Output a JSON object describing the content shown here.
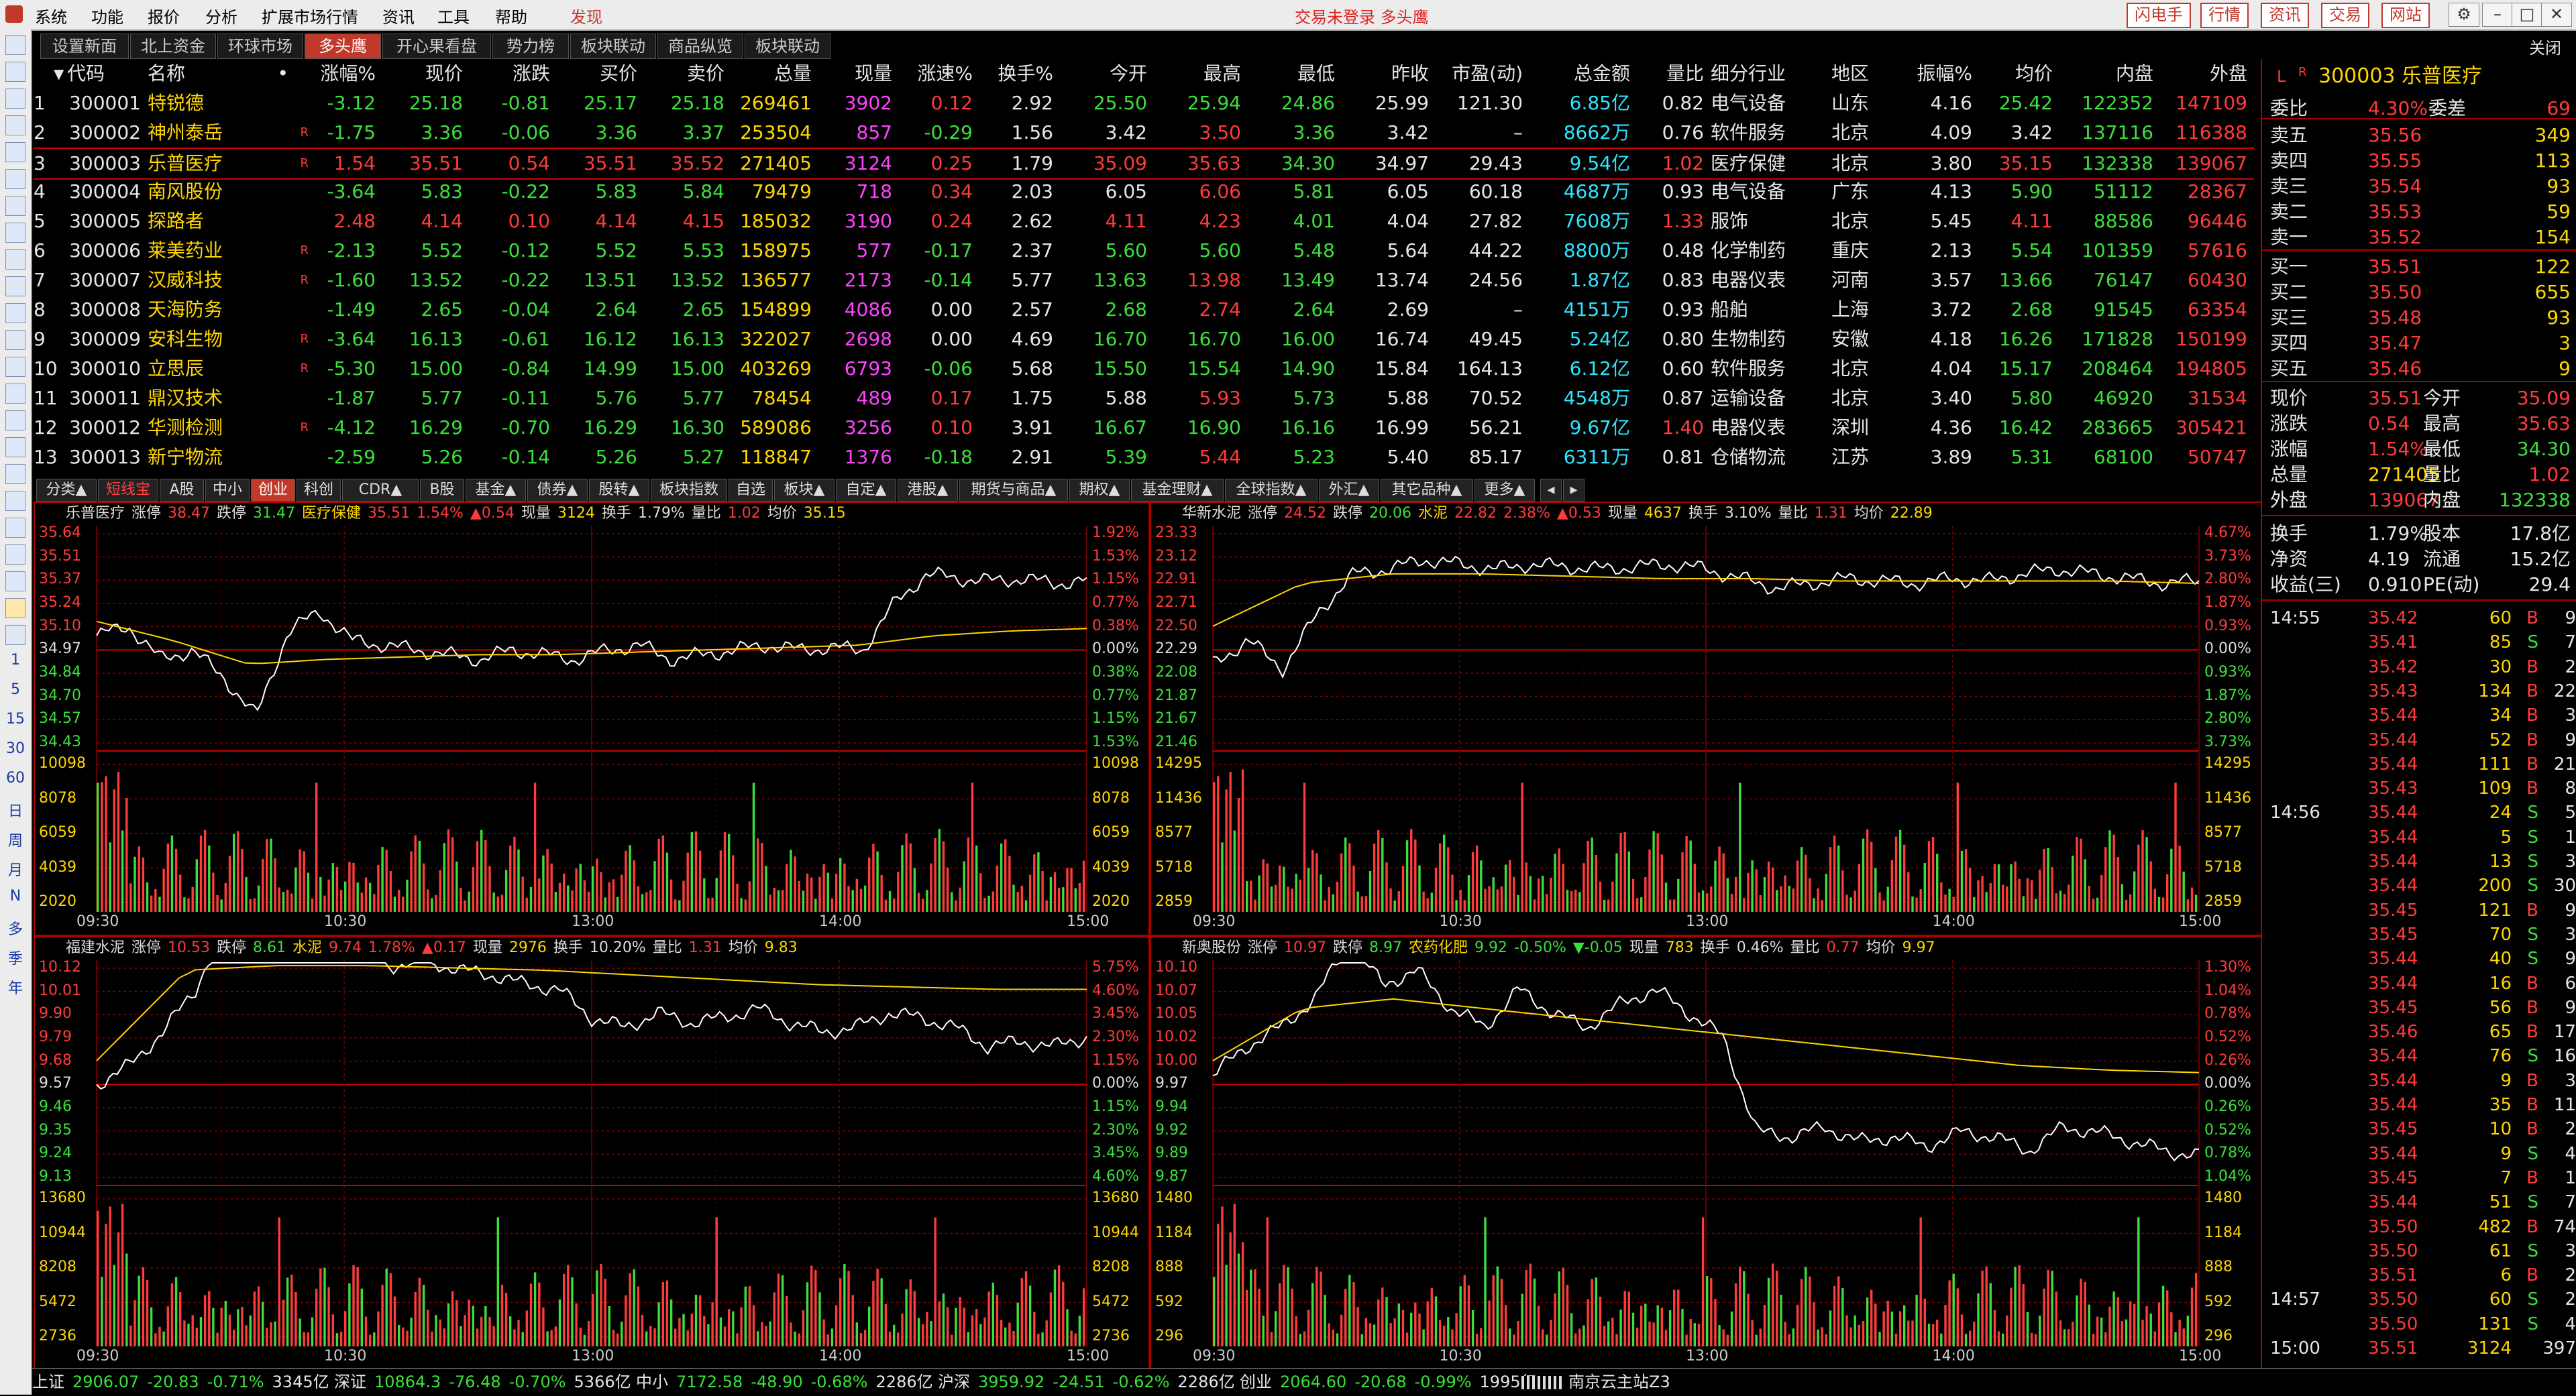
{
  "menubar": {
    "items": [
      "系统",
      "功能",
      "报价",
      "分析",
      "扩展市场行情",
      "资讯",
      "工具",
      "帮助",
      "发现"
    ],
    "notice": "交易未登录 多头鹰",
    "right_buttons": [
      "闪电手",
      "行情",
      "资讯",
      "交易",
      "网站"
    ],
    "close_label": "关闭"
  },
  "left_toolbar": {
    "text_buttons": [
      "1",
      "5",
      "15",
      "30",
      "60",
      "日",
      "周",
      "月",
      "N",
      "多",
      "季",
      "年"
    ]
  },
  "top_tabs": [
    "设置新面",
    "北上资金",
    "环球市场",
    "多头鹰",
    "开心果看盘",
    "势力榜",
    "板块联动",
    "商品纵览",
    "板块联动"
  ],
  "table": {
    "headers": [
      "代码",
      "名称",
      "•",
      "涨幅%",
      "现价",
      "涨跌",
      "买价",
      "卖价",
      "总量",
      "现量",
      "涨速%",
      "换手%",
      "今开",
      "最高",
      "最低",
      "昨收",
      "市盈(动)",
      "总金额",
      "量比",
      "细分行业",
      "地区",
      "振幅%",
      "均价",
      "内盘",
      "外盘"
    ],
    "rows": [
      {
        "n": "1",
        "code": "300001",
        "name": "特锐德",
        "r": "",
        "chg": "-3.12",
        "price": "25.18",
        "diff": "-0.81",
        "bid": "25.17",
        "ask": "25.18",
        "vol": "269461",
        "cur": "3902",
        "spd": "0.12",
        "turn": "2.92",
        "open": "25.50",
        "high": "25.94",
        "low": "24.86",
        "prev": "25.99",
        "pe": "121.30",
        "amt": "6.85亿",
        "vr": "0.82",
        "ind": "电气设备",
        "reg": "山东",
        "amp": "4.16",
        "avg": "25.42",
        "inner": "122352",
        "outer": "147109"
      },
      {
        "n": "2",
        "code": "300002",
        "name": "神州泰岳",
        "r": "R",
        "chg": "-1.75",
        "price": "3.36",
        "diff": "-0.06",
        "bid": "3.36",
        "ask": "3.37",
        "vol": "253504",
        "cur": "857",
        "spd": "-0.29",
        "turn": "1.56",
        "open": "3.42",
        "high": "3.50",
        "low": "3.36",
        "prev": "3.42",
        "pe": "–",
        "amt": "8662万",
        "vr": "0.76",
        "ind": "软件服务",
        "reg": "北京",
        "amp": "4.09",
        "avg": "3.42",
        "inner": "137116",
        "outer": "116388"
      },
      {
        "n": "3",
        "code": "300003",
        "name": "乐普医疗",
        "r": "R",
        "chg": "1.54",
        "price": "35.51",
        "diff": "0.54",
        "bid": "35.51",
        "ask": "35.52",
        "vol": "271405",
        "cur": "3124",
        "spd": "0.25",
        "turn": "1.79",
        "open": "35.09",
        "high": "35.63",
        "low": "34.30",
        "prev": "34.97",
        "pe": "29.43",
        "amt": "9.54亿",
        "vr": "1.02",
        "ind": "医疗保健",
        "reg": "北京",
        "amp": "3.80",
        "avg": "35.15",
        "inner": "132338",
        "outer": "139067"
      },
      {
        "n": "4",
        "code": "300004",
        "name": "南风股份",
        "r": "",
        "chg": "-3.64",
        "price": "5.83",
        "diff": "-0.22",
        "bid": "5.83",
        "ask": "5.84",
        "vol": "79479",
        "cur": "718",
        "spd": "0.34",
        "turn": "2.03",
        "open": "6.05",
        "high": "6.06",
        "low": "5.81",
        "prev": "6.05",
        "pe": "60.18",
        "amt": "4687万",
        "vr": "0.93",
        "ind": "电气设备",
        "reg": "广东",
        "amp": "4.13",
        "avg": "5.90",
        "inner": "51112",
        "outer": "28367"
      },
      {
        "n": "5",
        "code": "300005",
        "name": "探路者",
        "r": "",
        "chg": "2.48",
        "price": "4.14",
        "diff": "0.10",
        "bid": "4.14",
        "ask": "4.15",
        "vol": "185032",
        "cur": "3190",
        "spd": "0.24",
        "turn": "2.62",
        "open": "4.11",
        "high": "4.23",
        "low": "4.01",
        "prev": "4.04",
        "pe": "27.82",
        "amt": "7608万",
        "vr": "1.33",
        "ind": "服饰",
        "reg": "北京",
        "amp": "5.45",
        "avg": "4.11",
        "inner": "88586",
        "outer": "96446"
      },
      {
        "n": "6",
        "code": "300006",
        "name": "莱美药业",
        "r": "R",
        "chg": "-2.13",
        "price": "5.52",
        "diff": "-0.12",
        "bid": "5.52",
        "ask": "5.53",
        "vol": "158975",
        "cur": "577",
        "spd": "-0.17",
        "turn": "2.37",
        "open": "5.60",
        "high": "5.60",
        "low": "5.48",
        "prev": "5.64",
        "pe": "44.22",
        "amt": "8800万",
        "vr": "0.48",
        "ind": "化学制药",
        "reg": "重庆",
        "amp": "2.13",
        "avg": "5.54",
        "inner": "101359",
        "outer": "57616"
      },
      {
        "n": "7",
        "code": "300007",
        "name": "汉威科技",
        "r": "R",
        "chg": "-1.60",
        "price": "13.52",
        "diff": "-0.22",
        "bid": "13.51",
        "ask": "13.52",
        "vol": "136577",
        "cur": "2173",
        "spd": "-0.14",
        "turn": "5.77",
        "open": "13.63",
        "high": "13.98",
        "low": "13.49",
        "prev": "13.74",
        "pe": "24.56",
        "amt": "1.87亿",
        "vr": "0.83",
        "ind": "电器仪表",
        "reg": "河南",
        "amp": "3.57",
        "avg": "13.66",
        "inner": "76147",
        "outer": "60430"
      },
      {
        "n": "8",
        "code": "300008",
        "name": "天海防务",
        "r": "",
        "chg": "-1.49",
        "price": "2.65",
        "diff": "-0.04",
        "bid": "2.64",
        "ask": "2.65",
        "vol": "154899",
        "cur": "4086",
        "spd": "0.00",
        "turn": "2.57",
        "open": "2.68",
        "high": "2.74",
        "low": "2.64",
        "prev": "2.69",
        "pe": "–",
        "amt": "4151万",
        "vr": "0.93",
        "ind": "船舶",
        "reg": "上海",
        "amp": "3.72",
        "avg": "2.68",
        "inner": "91545",
        "outer": "63354"
      },
      {
        "n": "9",
        "code": "300009",
        "name": "安科生物",
        "r": "R",
        "chg": "-3.64",
        "price": "16.13",
        "diff": "-0.61",
        "bid": "16.12",
        "ask": "16.13",
        "vol": "322027",
        "cur": "2698",
        "spd": "0.00",
        "turn": "4.69",
        "open": "16.70",
        "high": "16.70",
        "low": "16.00",
        "prev": "16.74",
        "pe": "49.45",
        "amt": "5.24亿",
        "vr": "0.80",
        "ind": "生物制药",
        "reg": "安徽",
        "amp": "4.18",
        "avg": "16.26",
        "inner": "171828",
        "outer": "150199"
      },
      {
        "n": "10",
        "code": "300010",
        "name": "立思辰",
        "r": "R",
        "chg": "-5.30",
        "price": "15.00",
        "diff": "-0.84",
        "bid": "14.99",
        "ask": "15.00",
        "vol": "403269",
        "cur": "6793",
        "spd": "-0.06",
        "turn": "5.68",
        "open": "15.50",
        "high": "15.54",
        "low": "14.90",
        "prev": "15.84",
        "pe": "164.13",
        "amt": "6.12亿",
        "vr": "0.60",
        "ind": "软件服务",
        "reg": "北京",
        "amp": "4.04",
        "avg": "15.17",
        "inner": "208464",
        "outer": "194805"
      },
      {
        "n": "11",
        "code": "300011",
        "name": "鼎汉技术",
        "r": "",
        "chg": "-1.87",
        "price": "5.77",
        "diff": "-0.11",
        "bid": "5.76",
        "ask": "5.77",
        "vol": "78454",
        "cur": "489",
        "spd": "0.17",
        "turn": "1.75",
        "open": "5.88",
        "high": "5.93",
        "low": "5.73",
        "prev": "5.88",
        "pe": "70.52",
        "amt": "4548万",
        "vr": "0.87",
        "ind": "运输设备",
        "reg": "北京",
        "amp": "3.40",
        "avg": "5.80",
        "inner": "46920",
        "outer": "31534"
      },
      {
        "n": "12",
        "code": "300012",
        "name": "华测检测",
        "r": "R",
        "chg": "-4.12",
        "price": "16.29",
        "diff": "-0.70",
        "bid": "16.29",
        "ask": "16.30",
        "vol": "589086",
        "cur": "3256",
        "spd": "0.10",
        "turn": "3.91",
        "open": "16.67",
        "high": "16.90",
        "low": "16.16",
        "prev": "16.99",
        "pe": "56.21",
        "amt": "9.67亿",
        "vr": "1.40",
        "ind": "电器仪表",
        "reg": "深圳",
        "amp": "4.36",
        "avg": "16.42",
        "inner": "283665",
        "outer": "305421"
      },
      {
        "n": "13",
        "code": "300013",
        "name": "新宁物流",
        "r": "",
        "chg": "-2.59",
        "price": "5.26",
        "diff": "-0.14",
        "bid": "5.26",
        "ask": "5.27",
        "vol": "118847",
        "cur": "1376",
        "spd": "-0.18",
        "turn": "2.91",
        "open": "5.39",
        "high": "5.44",
        "low": "5.23",
        "prev": "5.40",
        "pe": "85.17",
        "amt": "6311万",
        "vr": "0.81",
        "ind": "仓储物流",
        "reg": "江苏",
        "amp": "3.89",
        "avg": "5.31",
        "inner": "68100",
        "outer": "50747"
      }
    ]
  },
  "bottom_tabs": [
    "分类▲",
    "短线宝",
    "A股",
    "中小",
    "创业",
    "科创",
    "CDR▲",
    "B股",
    "基金▲",
    "债券▲",
    "股转▲",
    "板块指数",
    "自选",
    "板块▲",
    "自定▲",
    "港股▲",
    "期货与商品▲",
    "期权▲",
    "基金理财▲",
    "全球指数▲",
    "外汇▲",
    "其它品种▲",
    "更多▲"
  ],
  "charts": [
    {
      "name": "乐普医疗",
      "limit_up": "38.47",
      "limit_down": "31.47",
      "sector": "医疗保健",
      "price": "35.51",
      "pct": "1.54%",
      "chg": "▲0.54",
      "cur_vol": "3124",
      "turnover": "1.79%",
      "vol_ratio": "1.02",
      "avg": "35.15",
      "price_ticks": [
        "35.64",
        "35.51",
        "35.37",
        "35.24",
        "35.10",
        "34.97",
        "34.84",
        "34.70",
        "34.57",
        "34.43"
      ],
      "pct_ticks": [
        "1.92%",
        "1.53%",
        "1.15%",
        "0.77%",
        "0.38%",
        "0.00%",
        "0.38%",
        "0.77%",
        "1.15%",
        "1.53%"
      ],
      "vol_ticks": [
        "10098",
        "8078",
        "6059",
        "4039",
        "2020"
      ],
      "base_pct": "0.00%"
    },
    {
      "name": "华新水泥",
      "limit_up": "24.52",
      "limit_down": "20.06",
      "sector": "水泥",
      "price": "22.82",
      "pct": "2.38%",
      "chg": "▲0.53",
      "cur_vol": "4637",
      "turnover": "3.10%",
      "vol_ratio": "1.31",
      "avg": "22.89",
      "price_ticks": [
        "23.33",
        "23.12",
        "22.91",
        "22.71",
        "22.50",
        "22.29",
        "22.08",
        "21.87",
        "21.67",
        "21.46"
      ],
      "pct_ticks": [
        "4.67%",
        "3.73%",
        "2.80%",
        "1.87%",
        "0.93%",
        "0.00%",
        "0.93%",
        "1.87%",
        "2.80%",
        "3.73%"
      ],
      "vol_ticks": [
        "14295",
        "11436",
        "8577",
        "5718",
        "2859"
      ],
      "base_pct": "0.00%"
    },
    {
      "name": "福建水泥",
      "limit_up": "10.53",
      "limit_down": "8.61",
      "sector": "水泥",
      "price": "9.74",
      "pct": "1.78%",
      "chg": "▲0.17",
      "cur_vol": "2976",
      "turnover": "10.20%",
      "vol_ratio": "1.31",
      "avg": "9.83",
      "price_ticks": [
        "10.12",
        "10.01",
        "9.90",
        "9.79",
        "9.68",
        "9.57",
        "9.46",
        "9.35",
        "9.24",
        "9.13"
      ],
      "pct_ticks": [
        "5.75%",
        "4.60%",
        "3.45%",
        "2.30%",
        "1.15%",
        "0.00%",
        "1.15%",
        "2.30%",
        "3.45%",
        "4.60%"
      ],
      "vol_ticks": [
        "13680",
        "10944",
        "8208",
        "5472",
        "2736"
      ],
      "base_pct": "0.00%"
    },
    {
      "name": "新奥股份",
      "limit_up": "10.97",
      "limit_down": "8.97",
      "sector": "农药化肥",
      "price": "9.92",
      "pct": "-0.50%",
      "chg": "▼-0.05",
      "cur_vol": "783",
      "turnover": "0.46%",
      "vol_ratio": "0.77",
      "avg": "9.97",
      "price_ticks": [
        "10.10",
        "10.07",
        "10.05",
        "10.02",
        "10.00",
        "9.97",
        "9.94",
        "9.92",
        "9.89",
        "9.87"
      ],
      "pct_ticks": [
        "1.30%",
        "1.04%",
        "0.78%",
        "0.52%",
        "0.26%",
        "0.00%",
        "0.26%",
        "0.52%",
        "0.78%",
        "1.04%"
      ],
      "vol_ticks": [
        "1480",
        "1184",
        "888",
        "592",
        "296"
      ],
      "base_pct": "0.00%"
    }
  ],
  "x_ticks": [
    "09:30",
    "10:30",
    "13:00",
    "14:00",
    "15:00"
  ],
  "labels": {
    "limit_up": "涨停",
    "limit_down": "跌停",
    "cur_vol": "现量",
    "turnover": "换手",
    "vol_ratio": "量比",
    "avg": "均价"
  },
  "quote": {
    "code": "300003",
    "name": "乐普医疗",
    "flag_l": "L",
    "flag_r": "R",
    "webi_label": "委比",
    "webi": "4.30%",
    "weicha_label": "委差",
    "weicha": "69",
    "asks": [
      {
        "l": "卖五",
        "p": "35.56",
        "v": "349"
      },
      {
        "l": "卖四",
        "p": "35.55",
        "v": "113"
      },
      {
        "l": "卖三",
        "p": "35.54",
        "v": "93"
      },
      {
        "l": "卖二",
        "p": "35.53",
        "v": "59"
      },
      {
        "l": "卖一",
        "p": "35.52",
        "v": "154"
      }
    ],
    "bids": [
      {
        "l": "买一",
        "p": "35.51",
        "v": "122"
      },
      {
        "l": "买二",
        "p": "35.50",
        "v": "655"
      },
      {
        "l": "买三",
        "p": "35.48",
        "v": "93"
      },
      {
        "l": "买四",
        "p": "35.47",
        "v": "3"
      },
      {
        "l": "买五",
        "p": "35.46",
        "v": "9"
      }
    ],
    "stats": [
      {
        "l1": "现价",
        "v1": "35.51",
        "l2": "今开",
        "v2": "35.09"
      },
      {
        "l1": "涨跌",
        "v1": "0.54",
        "l2": "最高",
        "v2": "35.63"
      },
      {
        "l1": "涨幅",
        "v1": "1.54%",
        "l2": "最低",
        "v2": "34.30"
      },
      {
        "l1": "总量",
        "v1": "271405",
        "l2": "量比",
        "v2": "1.02"
      },
      {
        "l1": "外盘",
        "v1": "139067",
        "l2": "内盘",
        "v2": "132338"
      }
    ],
    "stats2": [
      {
        "l1": "换手",
        "v1": "1.79%",
        "l2": "股本",
        "v2": "17.8亿"
      },
      {
        "l1": "净资",
        "v1": "4.19",
        "l2": "流通",
        "v2": "15.2亿"
      },
      {
        "l1": "收益(三)",
        "v1": "0.910",
        "l2": "PE(动)",
        "v2": "29.4"
      }
    ],
    "ticks": [
      {
        "t": "14:55",
        "p": "35.42",
        "v": "60",
        "d": "B",
        "n": "9"
      },
      {
        "t": "",
        "p": "35.41",
        "v": "85",
        "d": "S",
        "n": "7"
      },
      {
        "t": "",
        "p": "35.42",
        "v": "30",
        "d": "B",
        "n": "2"
      },
      {
        "t": "",
        "p": "35.43",
        "v": "134",
        "d": "B",
        "n": "22"
      },
      {
        "t": "",
        "p": "35.44",
        "v": "34",
        "d": "B",
        "n": "3"
      },
      {
        "t": "",
        "p": "35.44",
        "v": "52",
        "d": "B",
        "n": "9"
      },
      {
        "t": "",
        "p": "35.44",
        "v": "111",
        "d": "B",
        "n": "21"
      },
      {
        "t": "",
        "p": "35.43",
        "v": "109",
        "d": "B",
        "n": "8"
      },
      {
        "t": "14:56",
        "p": "35.44",
        "v": "24",
        "d": "S",
        "n": "5"
      },
      {
        "t": "",
        "p": "35.44",
        "v": "5",
        "d": "S",
        "n": "1"
      },
      {
        "t": "",
        "p": "35.44",
        "v": "13",
        "d": "S",
        "n": "3"
      },
      {
        "t": "",
        "p": "35.44",
        "v": "200",
        "d": "S",
        "n": "30"
      },
      {
        "t": "",
        "p": "35.45",
        "v": "121",
        "d": "B",
        "n": "9"
      },
      {
        "t": "",
        "p": "35.45",
        "v": "70",
        "d": "S",
        "n": "3"
      },
      {
        "t": "",
        "p": "35.44",
        "v": "40",
        "d": "S",
        "n": "9"
      },
      {
        "t": "",
        "p": "35.44",
        "v": "16",
        "d": "B",
        "n": "6"
      },
      {
        "t": "",
        "p": "35.45",
        "v": "56",
        "d": "B",
        "n": "9"
      },
      {
        "t": "",
        "p": "35.46",
        "v": "65",
        "d": "B",
        "n": "17"
      },
      {
        "t": "",
        "p": "35.44",
        "v": "76",
        "d": "S",
        "n": "16"
      },
      {
        "t": "",
        "p": "35.44",
        "v": "9",
        "d": "B",
        "n": "3"
      },
      {
        "t": "",
        "p": "35.44",
        "v": "35",
        "d": "B",
        "n": "11"
      },
      {
        "t": "",
        "p": "35.45",
        "v": "10",
        "d": "B",
        "n": "2"
      },
      {
        "t": "",
        "p": "35.44",
        "v": "9",
        "d": "S",
        "n": "4"
      },
      {
        "t": "",
        "p": "35.45",
        "v": "7",
        "d": "B",
        "n": "1"
      },
      {
        "t": "",
        "p": "35.44",
        "v": "51",
        "d": "S",
        "n": "7"
      },
      {
        "t": "",
        "p": "35.50",
        "v": "482",
        "d": "B",
        "n": "74"
      },
      {
        "t": "",
        "p": "35.50",
        "v": "61",
        "d": "S",
        "n": "3"
      },
      {
        "t": "",
        "p": "35.51",
        "v": "6",
        "d": "B",
        "n": "2"
      },
      {
        "t": "14:57",
        "p": "35.50",
        "v": "60",
        "d": "S",
        "n": "2"
      },
      {
        "t": "",
        "p": "35.50",
        "v": "131",
        "d": "S",
        "n": "4"
      },
      {
        "t": "15:00",
        "p": "35.51",
        "v": "3124",
        "d": "",
        "n": "397"
      }
    ]
  },
  "status_bar": {
    "items": [
      {
        "name": "上证",
        "val": "2906.07",
        "chg": "-20.83",
        "pct": "-0.71%",
        "amt": "3345亿"
      },
      {
        "name": "深证",
        "val": "10864.3",
        "chg": "-76.48",
        "pct": "-0.70%",
        "amt": "5366亿"
      },
      {
        "name": "中小",
        "val": "7172.58",
        "chg": "-48.90",
        "pct": "-0.68%",
        "amt": "2286亿"
      },
      {
        "name": "沪深",
        "val": "3959.92",
        "chg": "-24.51",
        "pct": "-0.62%",
        "amt": "2286亿"
      },
      {
        "name": "创业",
        "val": "2064.60",
        "chg": "-20.68",
        "pct": "-0.99%",
        "amt": "1995亿"
      }
    ],
    "server": "南京云主站Z3"
  },
  "colors": {
    "up": "#ff3b3b",
    "down": "#3be03b",
    "price_line": "#ffffff",
    "avg_line": "#ffd700",
    "grid": "#a00000",
    "accent": "#c0392b"
  }
}
